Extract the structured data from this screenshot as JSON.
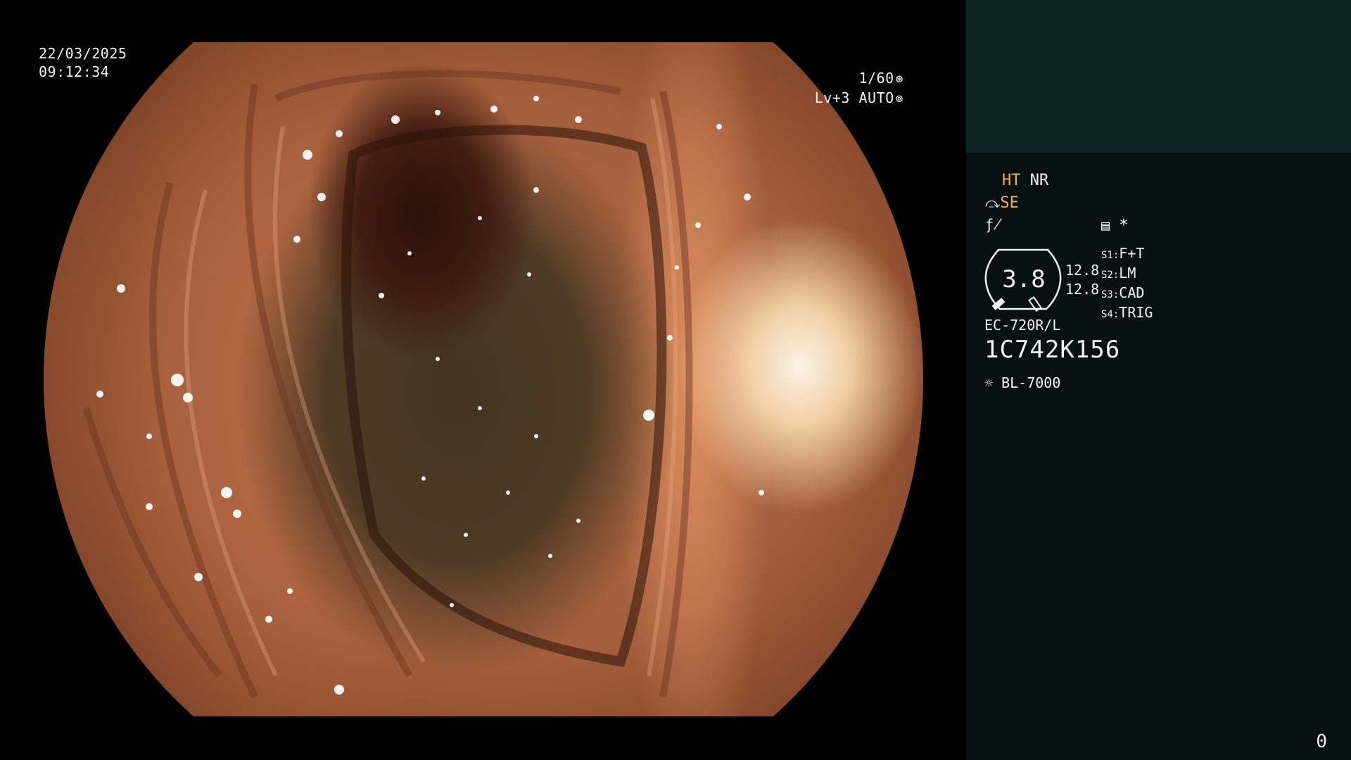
{
  "overlay": {
    "date": "22/03/2025",
    "time": "09:12:34",
    "shutter": "1/60",
    "shutter_icon": "aperture-icon",
    "level": "Lv+3",
    "exposure_mode": "AUTO",
    "exposure_icon": "iris-icon"
  },
  "panel": {
    "ht_label": "HT",
    "nr_label": "NR",
    "se_label": "SE",
    "se_icon": "angle-pointer-icon",
    "f_icon": "strikethrough-f-icon",
    "memo_icon": "document-list-icon",
    "star_label": "*",
    "gauge_value": "3.8",
    "level_values": [
      "12.8",
      "12.8"
    ],
    "scene_keys": [
      {
        "key": "S1:",
        "value": "F+T"
      },
      {
        "key": "S2:",
        "value": "LM"
      },
      {
        "key": "S3:",
        "value": "CAD"
      },
      {
        "key": "S4:",
        "value": "TRIG"
      }
    ],
    "scope_model": "EC-720R/L",
    "serial": "1C742K156",
    "light_icon": "sun-icon",
    "light_source": "BL-7000",
    "page_number": "0"
  },
  "colors": {
    "panel_top": "#0e2324",
    "panel_body": "#071110",
    "accent_orange": "#f2b24a",
    "text": "#f2f2f2"
  }
}
